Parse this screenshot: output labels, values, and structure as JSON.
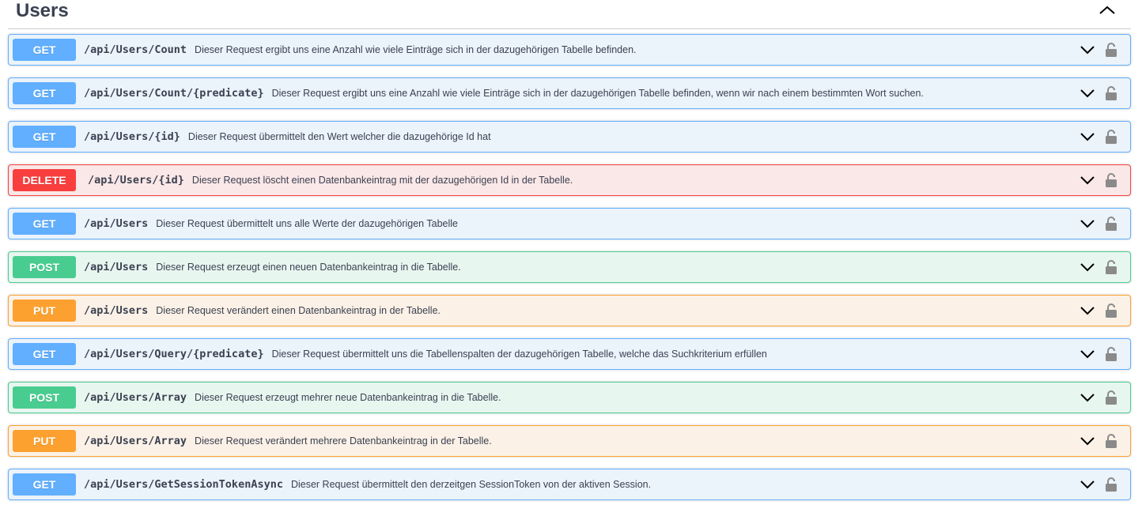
{
  "section": {
    "title": "Users",
    "collapse_icon": "chevron-up-icon"
  },
  "operations": [
    {
      "method": "GET",
      "kind": "get",
      "path": "/api/Users/Count",
      "summary": "Dieser Request ergibt uns eine Anzahl wie viele Einträge sich in der dazugehörigen Tabelle befinden."
    },
    {
      "method": "GET",
      "kind": "get",
      "path": "/api/Users/Count/{predicate}",
      "summary": "Dieser Request ergibt uns eine Anzahl wie viele Einträge sich in der dazugehörigen Tabelle befinden, wenn wir nach einem bestimmten Wort suchen."
    },
    {
      "method": "GET",
      "kind": "get",
      "path": "/api/Users/{id}",
      "summary": "Dieser Request übermittelt den Wert welcher die dazugehörige Id hat"
    },
    {
      "method": "DELETE",
      "kind": "delete",
      "path": "/api/Users/{id}",
      "summary": "Dieser Request löscht einen Datenbankeintrag mit der dazugehörigen Id in der Tabelle."
    },
    {
      "method": "GET",
      "kind": "get",
      "path": "/api/Users",
      "summary": "Dieser Request übermittelt uns alle Werte der dazugehörigen Tabelle"
    },
    {
      "method": "POST",
      "kind": "post",
      "path": "/api/Users",
      "summary": "Dieser Request erzeugt einen neuen Datenbankeintrag in die Tabelle."
    },
    {
      "method": "PUT",
      "kind": "put",
      "path": "/api/Users",
      "summary": "Dieser Request verändert einen Datenbankeintrag in der Tabelle."
    },
    {
      "method": "GET",
      "kind": "get",
      "path": "/api/Users/Query/{predicate}",
      "summary": "Dieser Request übermittelt uns die Tabellenspalten der dazugehörigen Tabelle, welche das Suchkriterium erfüllen"
    },
    {
      "method": "POST",
      "kind": "post",
      "path": "/api/Users/Array",
      "summary": "Dieser Request erzeugt mehrer neue Datenbankeintrag in die Tabelle."
    },
    {
      "method": "PUT",
      "kind": "put",
      "path": "/api/Users/Array",
      "summary": "Dieser Request verändert mehrere Datenbankeintrag in der Tabelle."
    },
    {
      "method": "GET",
      "kind": "get",
      "path": "/api/Users/GetSessionTokenAsync",
      "summary": "Dieser Request übermittelt den derzeitgen SessionToken von der aktiven Session."
    }
  ],
  "icons": {
    "expand": "chevron-down-icon",
    "auth": "lock-icon"
  },
  "colors": {
    "get": "#61affe",
    "delete": "#f93e3e",
    "post": "#49cc90",
    "put": "#fca130",
    "text": "#3b4151"
  }
}
